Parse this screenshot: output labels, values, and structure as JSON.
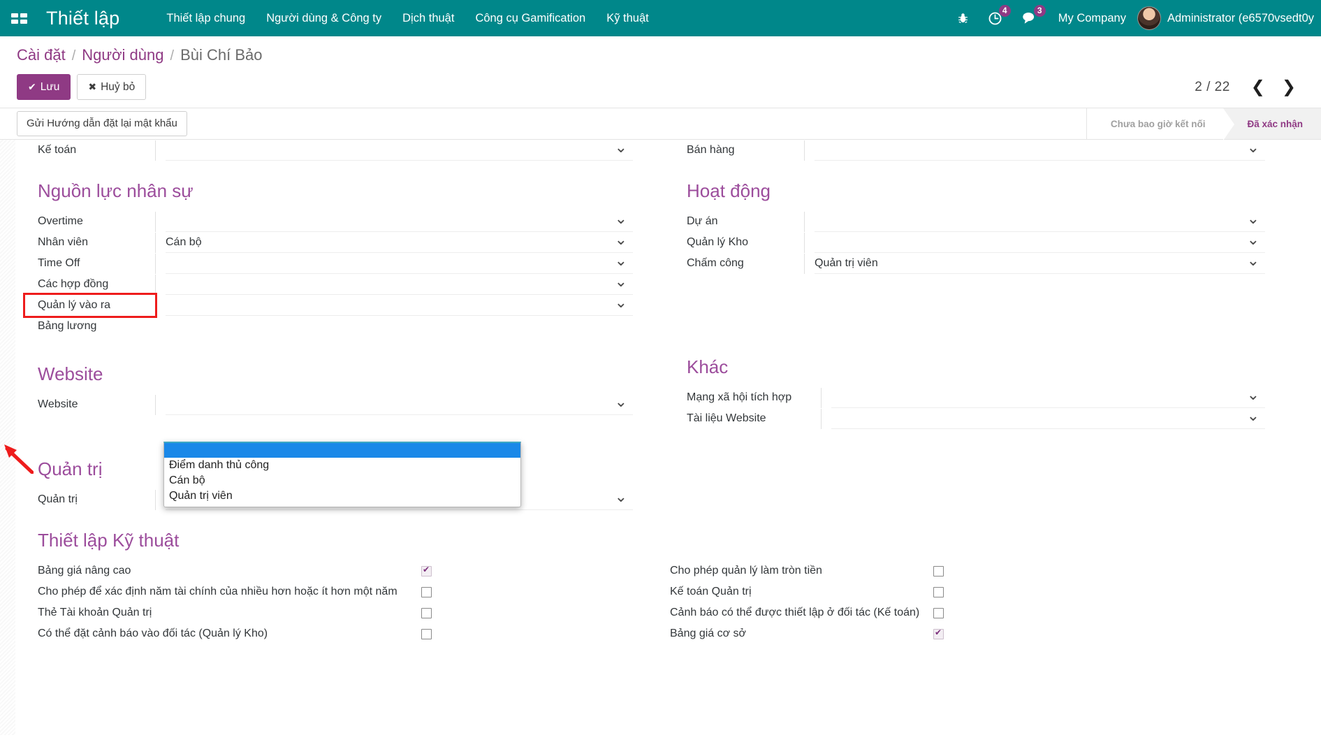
{
  "navbar": {
    "apps_icon": "apps-grid-icon",
    "brand": "Thiết lập",
    "menu": [
      {
        "label": "Thiết lập chung"
      },
      {
        "label": "Người dùng & Công ty"
      },
      {
        "label": "Dịch thuật"
      },
      {
        "label": "Công cụ Gamification"
      },
      {
        "label": "Kỹ thuật"
      }
    ],
    "icons": {
      "debug": "bug-icon",
      "activities": "clock-icon",
      "activities_count": "4",
      "messages": "chat-icon",
      "messages_count": "3"
    },
    "company": "My Company",
    "user": "Administrator (e6570vsedt0y",
    "accent_bg": "#00878a"
  },
  "breadcrumb": {
    "items": [
      {
        "label": "Cài đặt",
        "current": false
      },
      {
        "label": "Người dùng",
        "current": false
      },
      {
        "label": "Bùi Chí Bảo",
        "current": true
      }
    ],
    "separator": "/"
  },
  "control_panel": {
    "save_label": "Lưu",
    "save_icon": "check-icon",
    "discard_label": "Huỷ bỏ",
    "discard_icon": "times-icon",
    "pager_counter": "2 / 22",
    "prev_icon": "chevron-left-icon",
    "next_icon": "chevron-right-icon"
  },
  "statusbar": {
    "action_button": "Gửi Hướng dẫn đặt lại mật khẩu",
    "stages": [
      {
        "label": "Chưa bao giờ kết nối",
        "active": false
      },
      {
        "label": "Đã xác nhận",
        "active": true
      }
    ]
  },
  "form": {
    "top_partial": {
      "left_label": "Kế toán",
      "left_value": "",
      "right_label": "Bán hàng",
      "right_value": ""
    },
    "groups_left": [
      {
        "title": "Nguồn lực nhân sự",
        "fields": [
          {
            "label": "Overtime",
            "value": ""
          },
          {
            "label": "Nhân viên",
            "value": "Cán bộ"
          },
          {
            "label": "Time Off",
            "value": ""
          },
          {
            "label": "Các hợp đồng",
            "value": ""
          },
          {
            "label": "Quản lý vào ra",
            "value": "",
            "highlighted": true
          },
          {
            "label": "Bảng lương",
            "value": "",
            "no_control": true
          }
        ]
      },
      {
        "title": "Website",
        "fields": [
          {
            "label": "Website",
            "value": ""
          }
        ]
      },
      {
        "title": "Quản trị",
        "fields": [
          {
            "label": "Quản trị",
            "value": ""
          }
        ]
      }
    ],
    "groups_right": [
      {
        "title": "Hoạt động",
        "fields": [
          {
            "label": "Dự án",
            "value": ""
          },
          {
            "label": "Quản lý Kho",
            "value": ""
          },
          {
            "label": "Chấm công",
            "value": "Quản trị viên"
          }
        ]
      },
      {
        "title": "Khác",
        "fields": [
          {
            "label": "Mạng xã hội tích hợp",
            "value": ""
          },
          {
            "label": "Tài liệu Website",
            "value": ""
          }
        ]
      }
    ],
    "dropdown": {
      "open": true,
      "selected_index": 0,
      "options": [
        {
          "label": ""
        },
        {
          "label": "Điểm danh thủ công"
        },
        {
          "label": "Cán bộ"
        },
        {
          "label": "Quản trị viên"
        }
      ]
    },
    "technical": {
      "title": "Thiết lập Kỹ thuật",
      "left_items": [
        {
          "label": "Bảng giá nâng cao",
          "checked": true
        },
        {
          "label": "Cho phép để xác định năm tài chính của nhiều hơn hoặc ít hơn một năm",
          "checked": false
        },
        {
          "label": "Thẻ Tài khoản Quản trị",
          "checked": false
        },
        {
          "label": "Có thể đặt cảnh báo vào đối tác (Quản lý Kho)",
          "checked": false
        }
      ],
      "right_items": [
        {
          "label": "Cho phép quản lý làm tròn tiền",
          "checked": false
        },
        {
          "label": "Kế toán Quản trị",
          "checked": false
        },
        {
          "label": "Cảnh báo có thể được thiết lập ở đối tác (Kế toán)",
          "checked": false
        },
        {
          "label": "Bảng giá cơ sở",
          "checked": true
        }
      ]
    }
  },
  "annotation": {
    "highlight_color": "#ee1c1c",
    "arrow": "red-arrow-pointer"
  }
}
